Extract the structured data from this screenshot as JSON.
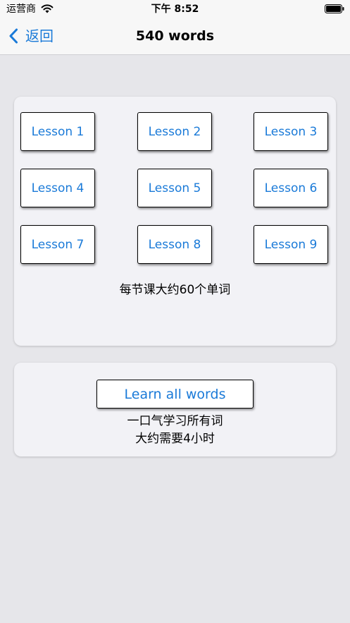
{
  "status_bar": {
    "carrier": "运营商",
    "time": "下午 8:52"
  },
  "nav": {
    "back_label": "返回",
    "title": "540 words"
  },
  "lessons": {
    "items": [
      "Lesson 1",
      "Lesson 2",
      "Lesson 3",
      "Lesson 4",
      "Lesson 5",
      "Lesson 6",
      "Lesson 7",
      "Lesson 8",
      "Lesson 9"
    ],
    "note": "每节课大约60个单词"
  },
  "all_words": {
    "button_label": "Learn all words",
    "note_line1": "一口气学习所有词",
    "note_line2": "大约需要4小时"
  },
  "colors": {
    "accent": "#1a7ad8",
    "background": "#e6e6ea",
    "card": "#f2f2f6",
    "bar": "#f7f7f7"
  }
}
